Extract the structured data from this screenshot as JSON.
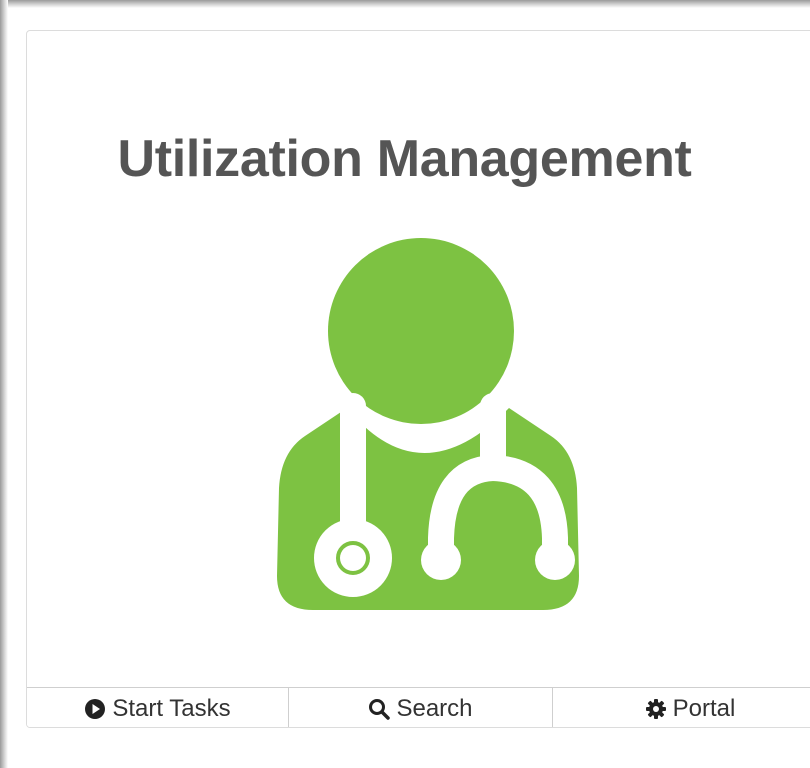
{
  "card": {
    "title": "Utilization Management",
    "icon": "doctor-stethoscope-icon",
    "accent_color": "#7dc242"
  },
  "footer": {
    "buttons": [
      {
        "label": "Start Tasks",
        "icon": "play-circle-icon"
      },
      {
        "label": "Search",
        "icon": "search-icon"
      },
      {
        "label": "Portal",
        "icon": "gear-icon"
      }
    ]
  }
}
